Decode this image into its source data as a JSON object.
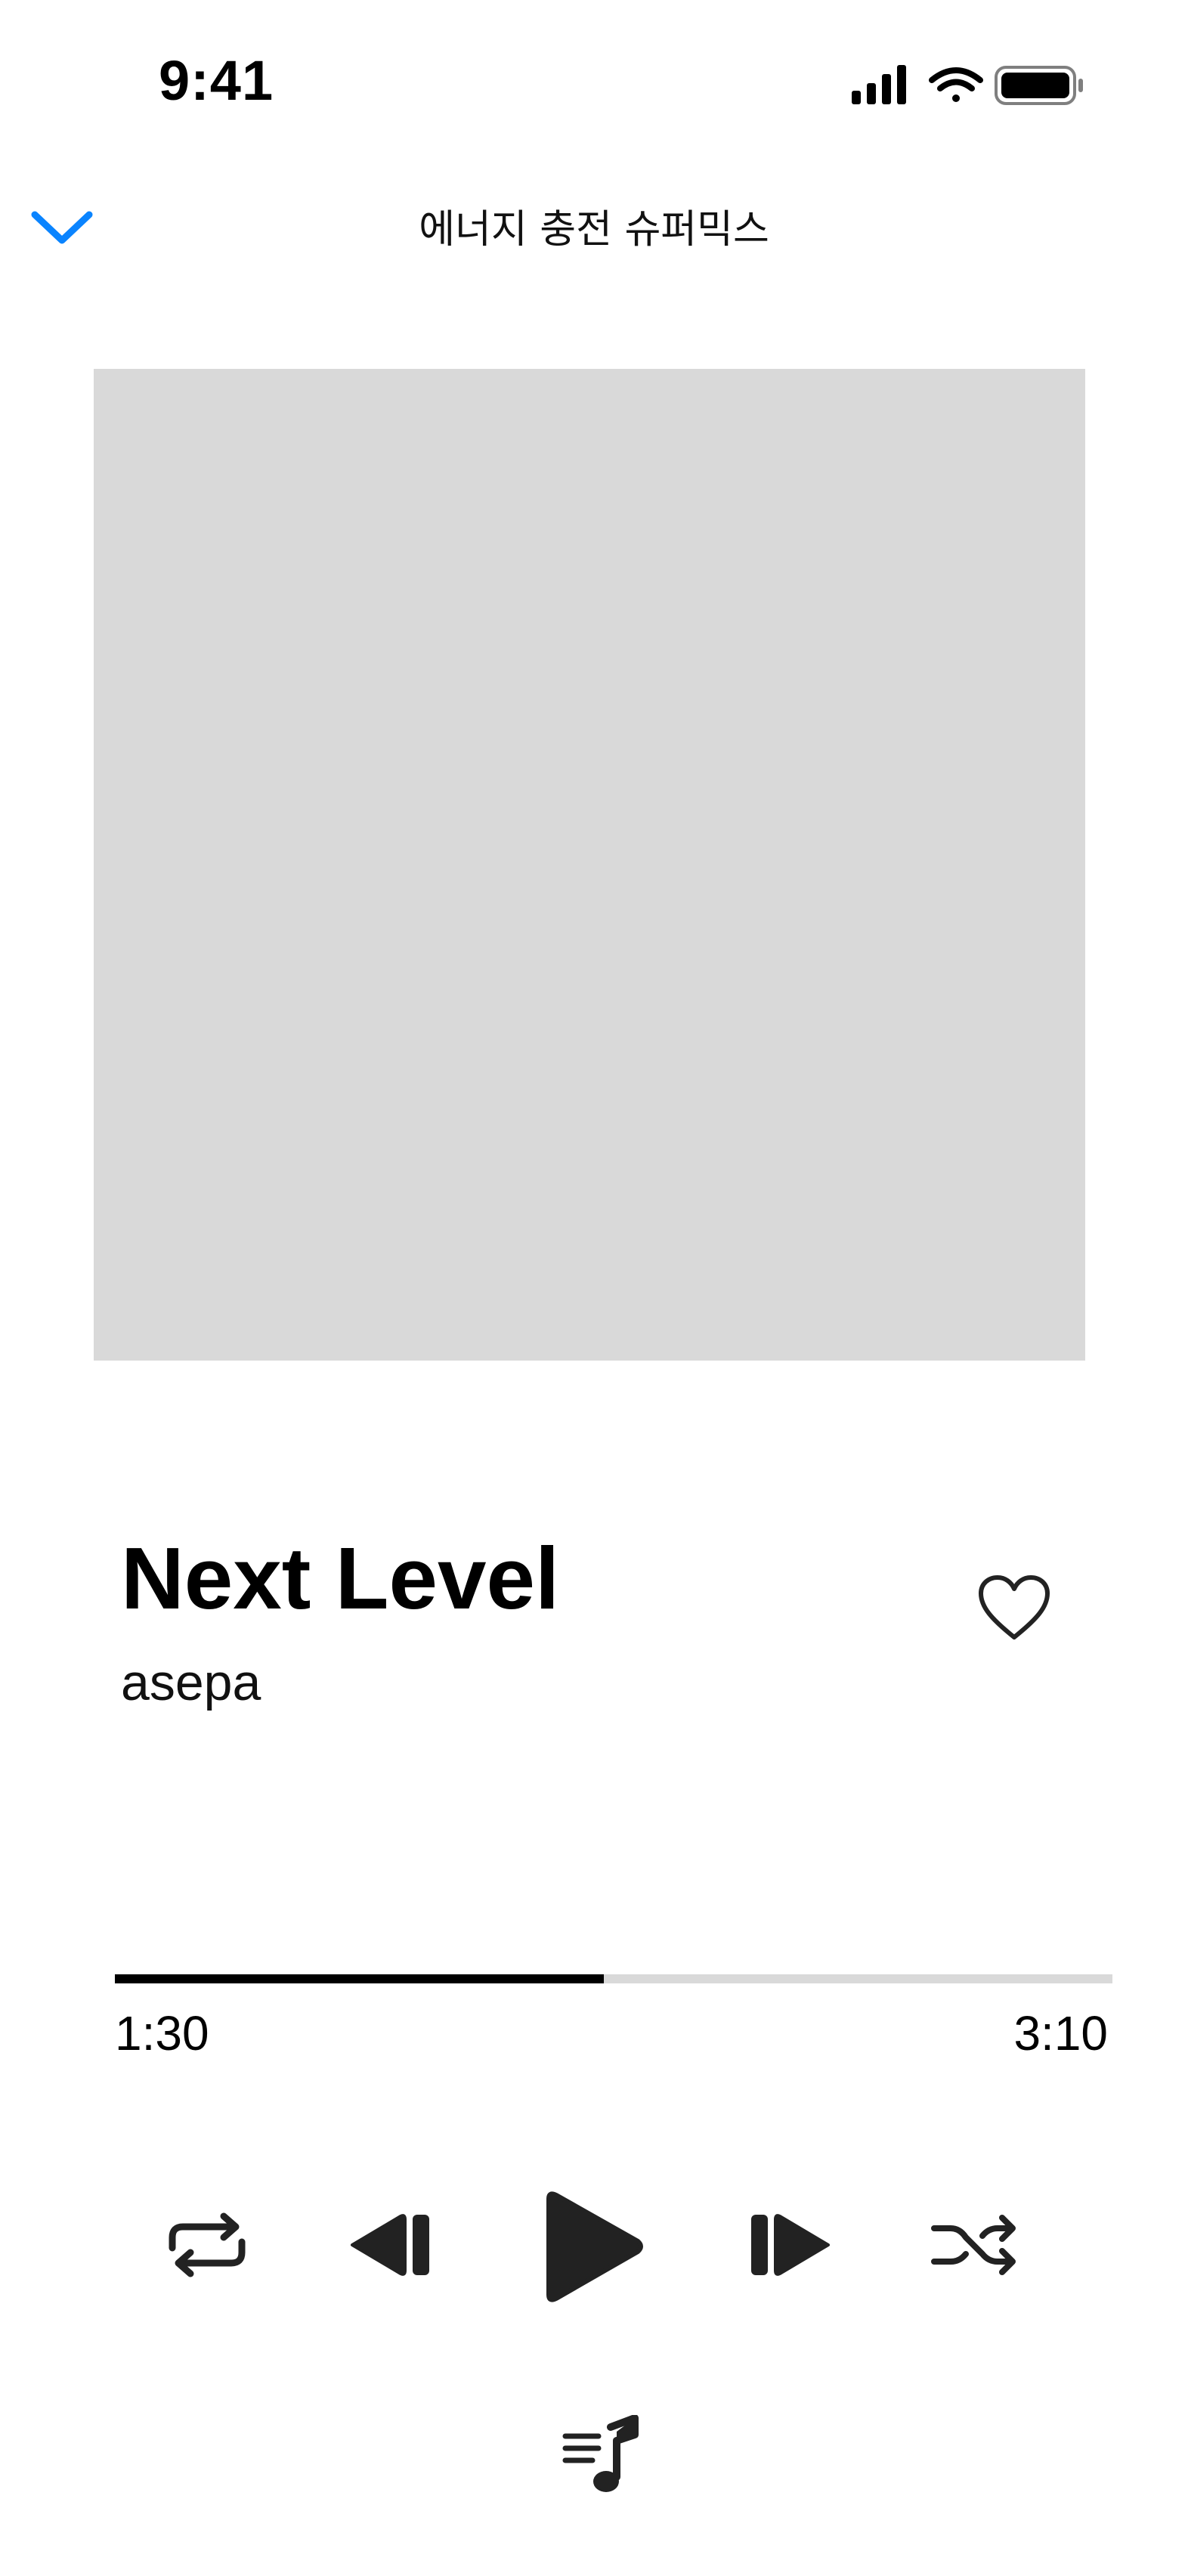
{
  "status_bar": {
    "time": "9:41",
    "icons": [
      "cellular-signal-icon",
      "wifi-icon",
      "battery-icon"
    ]
  },
  "header": {
    "back_icon": "chevron-down-icon",
    "playlist_title": "에너지 충전 슈퍼믹스"
  },
  "track": {
    "title": "Next Level",
    "artist": "asepa",
    "liked": false
  },
  "progress": {
    "elapsed": "1:30",
    "total": "3:10",
    "fraction": 0.49
  },
  "controls": [
    "repeat-icon",
    "previous-icon",
    "play-icon",
    "next-icon",
    "shuffle-icon"
  ],
  "queue_icon": "music-queue-icon",
  "colors": {
    "accent": "#0a84ff",
    "placeholder": "#d9d9d9",
    "icon": "#222222"
  }
}
